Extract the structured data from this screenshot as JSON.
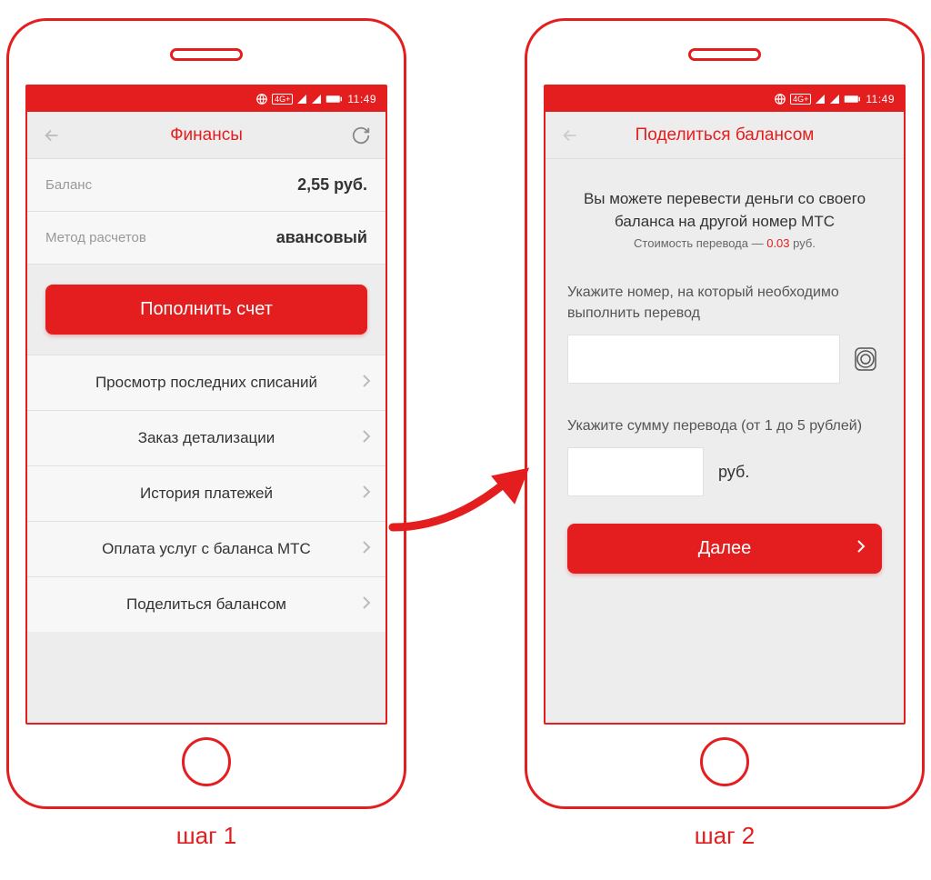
{
  "statusbar": {
    "time": "11:49",
    "indicators": "4G+"
  },
  "step1": {
    "label": "шаг 1",
    "appbar": {
      "title": "Финансы"
    },
    "balance": {
      "label": "Баланс",
      "value": "2,55 руб."
    },
    "method": {
      "label": "Метод расчетов",
      "value": "авансовый"
    },
    "topup_btn": "Пополнить счет",
    "menu": [
      "Просмотр последних списаний",
      "Заказ детализации",
      "История платежей",
      "Оплата услуг с баланса МТС",
      "Поделиться балансом"
    ]
  },
  "step2": {
    "label": "шаг 2",
    "appbar": {
      "title": "Поделиться балансом"
    },
    "desc": "Вы можете перевести деньги со своего баланса на другой номер МТС",
    "cost_prefix": "Стоимость перевода — ",
    "cost_value": "0.03",
    "cost_suffix": " руб.",
    "phone_label": "Укажите номер, на который необходимо выполнить перевод",
    "amount_label": "Укажите сумму перевода (от 1 до 5 рублей)",
    "amount_unit": "руб.",
    "next_btn": "Далее"
  }
}
